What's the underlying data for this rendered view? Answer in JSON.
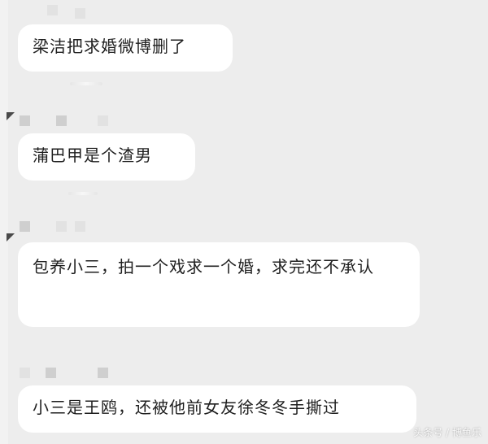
{
  "messages": [
    {
      "text": "梁洁把求婚微博删了"
    },
    {
      "text": "蒲巴甲是个渣男"
    },
    {
      "text": "包养小三，拍一个戏求一个婚，求完还不承认"
    },
    {
      "text": "小三是王鸥，还被他前女友徐冬冬手撕过"
    }
  ],
  "watermark": "头条号 / 博鱼乐",
  "colors": {
    "background": "#ededed",
    "bubble": "#ffffff",
    "text": "#1f1f1f"
  }
}
